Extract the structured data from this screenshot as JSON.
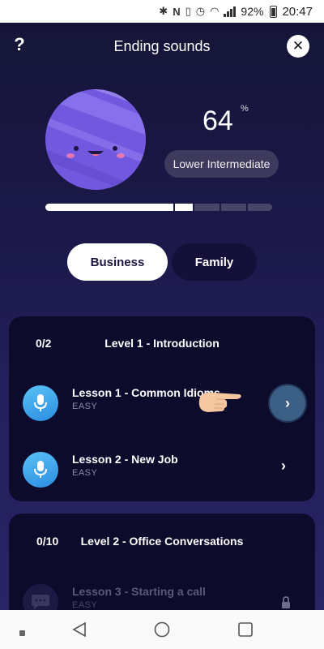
{
  "status_bar": {
    "battery": "92%",
    "time": "20:47",
    "icons": [
      "bluetooth-icon",
      "nfc-icon",
      "vibrate-icon",
      "alarm-icon",
      "wifi-icon",
      "signal-icon",
      "battery-icon"
    ]
  },
  "header": {
    "help_label": "?",
    "title": "Ending sounds",
    "close_label": "✕"
  },
  "score": {
    "value": "64",
    "unit": "%",
    "level": "Lower Intermediate",
    "progress_fraction": 0.64
  },
  "tabs": [
    {
      "label": "Business",
      "selected": true
    },
    {
      "label": "Family",
      "selected": false
    }
  ],
  "levels": [
    {
      "count": "0/2",
      "title": "Level 1 - Introduction",
      "lessons": [
        {
          "name": "Lesson 1 - Common Idioms",
          "difficulty": "EASY",
          "icon": "microphone-icon"
        },
        {
          "name": "Lesson 2 - New Job",
          "difficulty": "EASY",
          "icon": "microphone-icon"
        }
      ]
    },
    {
      "count": "0/10",
      "title": "Level 2 - Office Conversations",
      "lessons": [
        {
          "name": "Lesson 3 - Starting a call",
          "difficulty": "EASY",
          "icon": "chat-bubble-icon",
          "locked": true
        }
      ]
    }
  ],
  "colors": {
    "background": "#1b1848",
    "card": "#0d0b2c",
    "planet": "#6f55d9",
    "lesson_icon": "#3aa3ec",
    "go_button": "#3c5f85"
  }
}
